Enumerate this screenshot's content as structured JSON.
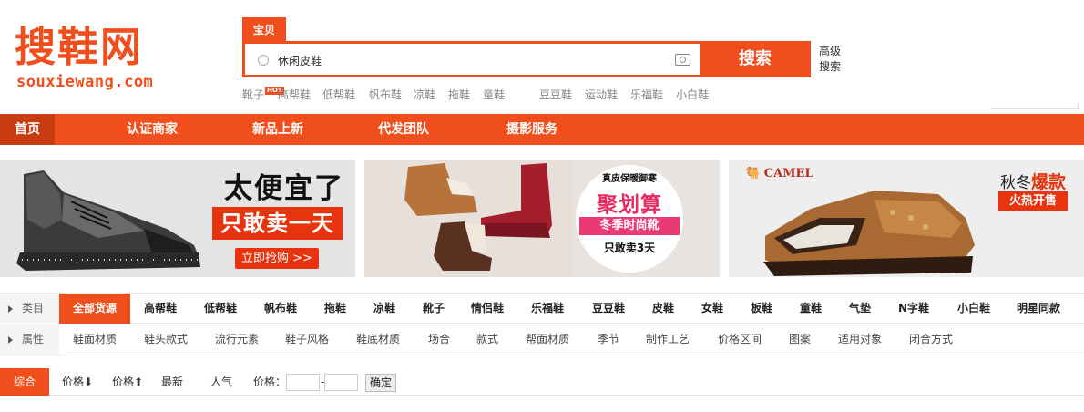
{
  "header": {
    "logo_cn": "搜鞋网",
    "logo_en": "souxiewang.com",
    "search_tab": "宝贝",
    "search_value": "休闲皮鞋",
    "search_button": "搜索",
    "advanced_search": "高级搜索",
    "hot_badge": "HOT",
    "hot_words": [
      "靴子",
      "高帮鞋",
      "低帮鞋",
      "帆布鞋",
      "凉鞋",
      "拖鞋",
      "童鞋",
      "豆豆鞋",
      "运动鞋",
      "乐福鞋",
      "小白鞋"
    ]
  },
  "nav": {
    "items": [
      "首页",
      "认证商家",
      "新品上新",
      "代发团队",
      "摄影服务"
    ]
  },
  "banners": {
    "b1": {
      "title": "太便宜了",
      "sub": "只敢卖一天",
      "button": "立即抢购 >>"
    },
    "b2": {
      "top": "真皮保暖御寒",
      "main": "聚划算",
      "sub": "冬季时尚靴",
      "foot": "只敢卖3天"
    },
    "b3": {
      "brand": "CAMEL",
      "title_pre": "秋冬",
      "title_hl": "爆款",
      "badge": "火热开售"
    }
  },
  "filters": {
    "category_label": "类目",
    "categories": [
      "全部货源",
      "高帮鞋",
      "低帮鞋",
      "帆布鞋",
      "拖鞋",
      "凉鞋",
      "靴子",
      "情侣鞋",
      "乐福鞋",
      "豆豆鞋",
      "皮鞋",
      "女鞋",
      "板鞋",
      "童鞋",
      "气垫",
      "N字鞋",
      "小白鞋",
      "明星同款"
    ],
    "attribute_label": "属性",
    "attributes": [
      "鞋面材质",
      "鞋头款式",
      "流行元素",
      "鞋子风格",
      "鞋底材质",
      "场合",
      "款式",
      "帮面材质",
      "季节",
      "制作工艺",
      "价格区间",
      "图案",
      "适用对象",
      "闭合方式"
    ]
  },
  "sort": {
    "active": "综合",
    "price_down": "价格⬇",
    "price_up": "价格⬆",
    "newest": "最新",
    "popular": "人气",
    "price_label": "价格：",
    "dash": "-",
    "confirm": "确定"
  },
  "colors": {
    "accent": "#f04e1c",
    "accent_dark": "#c73c10"
  }
}
